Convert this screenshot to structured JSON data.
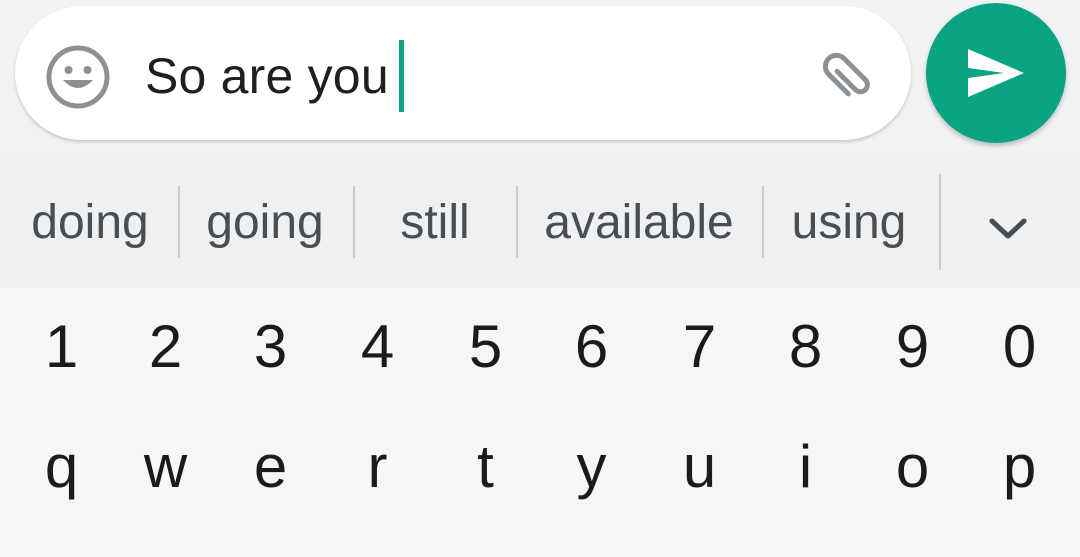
{
  "composer": {
    "text": "So are you",
    "emoji_icon": "smiley-face-icon",
    "attach_icon": "paperclip-icon",
    "send_icon": "send-arrow-icon",
    "accent_color": "#0aa383",
    "caret_color": "#18a085"
  },
  "suggestions": {
    "items": [
      "doing",
      "going",
      "still",
      "available",
      "using"
    ],
    "expand_icon": "chevron-down-icon"
  },
  "keyboard": {
    "number_row": [
      "1",
      "2",
      "3",
      "4",
      "5",
      "6",
      "7",
      "8",
      "9",
      "0"
    ],
    "letter_row": [
      "q",
      "w",
      "e",
      "r",
      "t",
      "y",
      "u",
      "i",
      "o",
      "p"
    ]
  }
}
